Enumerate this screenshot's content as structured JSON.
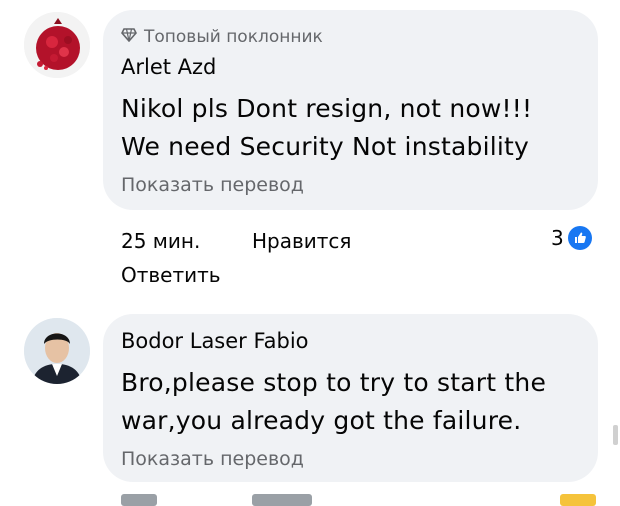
{
  "comments": [
    {
      "badge": "Топовый поклонник",
      "author": "Arlet Azd",
      "lines": [
        "Nikol pls Dont resign, not now!!!",
        "We need Security Not instability"
      ],
      "translate": "Показать перевод",
      "time": "25 мин.",
      "like": "Нравится",
      "reply": "Ответить",
      "reactions": "3"
    },
    {
      "author": "Bodor Laser Fabio",
      "lines": [
        "Bro,please stop to try to start the",
        "war,you already got the failure."
      ],
      "translate": "Показать перевод"
    }
  ],
  "colors": {
    "bubble": "#f0f2f5",
    "secondary": "#65676b",
    "like_blue": "#1877f2"
  },
  "icons": {
    "badge": "diamond-icon",
    "reaction": "thumbs-up-icon"
  }
}
